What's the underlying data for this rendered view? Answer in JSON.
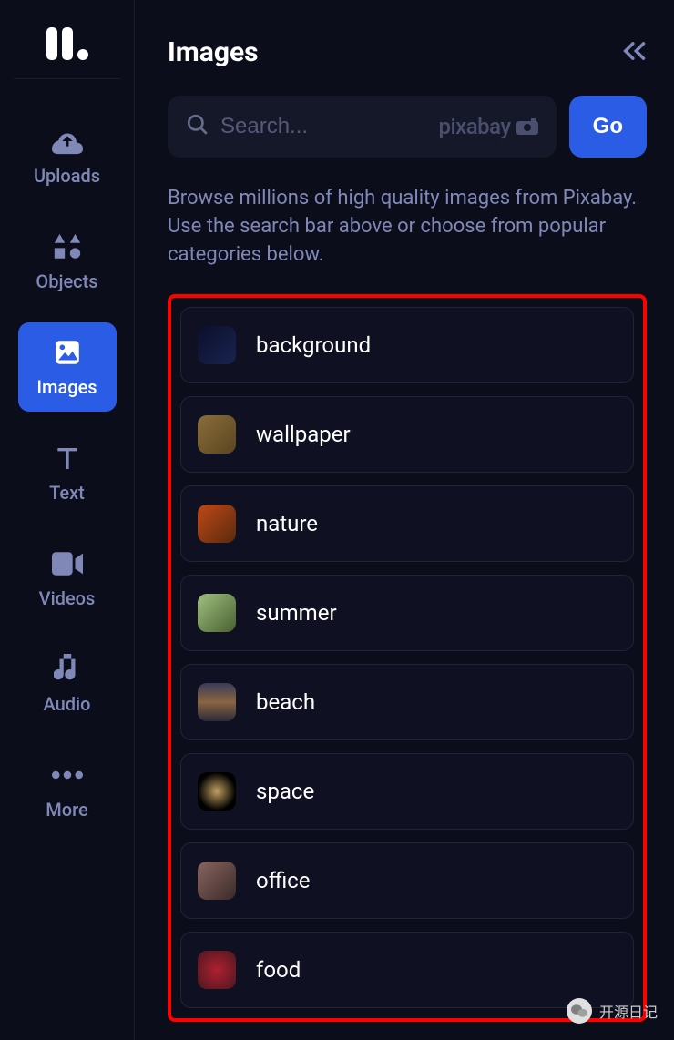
{
  "sidebar": {
    "items": [
      {
        "id": "uploads",
        "label": "Uploads",
        "icon": "cloud-upload-icon"
      },
      {
        "id": "objects",
        "label": "Objects",
        "icon": "shapes-icon"
      },
      {
        "id": "images",
        "label": "Images",
        "icon": "image-icon"
      },
      {
        "id": "text",
        "label": "Text",
        "icon": "text-icon"
      },
      {
        "id": "videos",
        "label": "Videos",
        "icon": "video-icon"
      },
      {
        "id": "audio",
        "label": "Audio",
        "icon": "music-icon"
      },
      {
        "id": "more",
        "label": "More",
        "icon": "more-icon"
      }
    ],
    "active_id": "images"
  },
  "panel": {
    "title": "Images",
    "search_placeholder": "Search...",
    "search_value": "",
    "provider_label": "pixabay",
    "go_label": "Go",
    "description": "Browse millions of high quality images from Pixabay. Use the search bar above or choose from popular categories below."
  },
  "categories": [
    {
      "id": "background",
      "label": "background"
    },
    {
      "id": "wallpaper",
      "label": "wallpaper"
    },
    {
      "id": "nature",
      "label": "nature"
    },
    {
      "id": "summer",
      "label": "summer"
    },
    {
      "id": "beach",
      "label": "beach"
    },
    {
      "id": "space",
      "label": "space"
    },
    {
      "id": "office",
      "label": "office"
    },
    {
      "id": "food",
      "label": "food"
    }
  ],
  "footer": {
    "badge_text": "开源日记"
  },
  "colors": {
    "background": "#0b0d1a",
    "panel_bg": "#151829",
    "accent": "#2b5ce6",
    "text_muted": "#8088b8",
    "text_primary": "#ffffff",
    "highlight_border": "#ff0000"
  }
}
